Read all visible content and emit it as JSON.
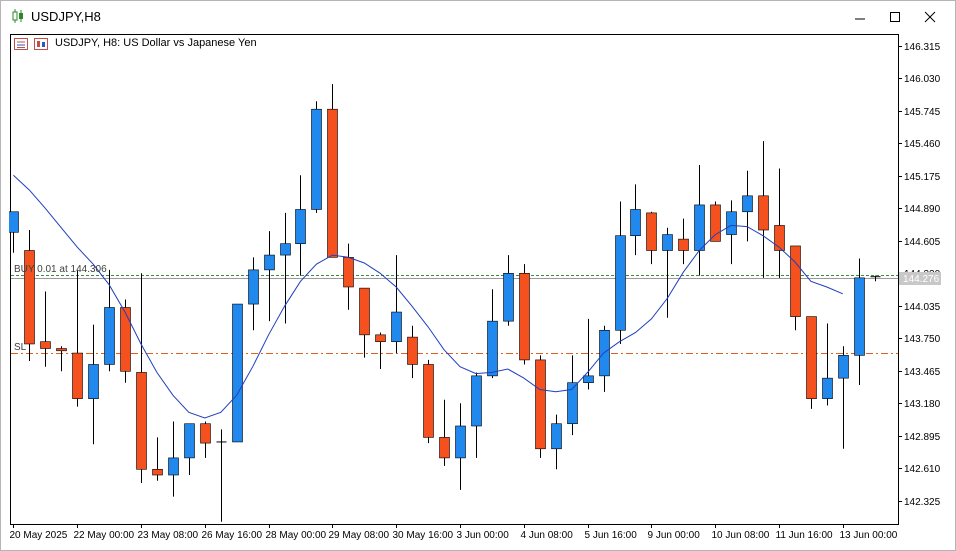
{
  "window": {
    "title": "USDJPY,H8"
  },
  "chart_header": {
    "description": "USDJPY, H8:  US Dollar vs Japanese Yen"
  },
  "trade_lines": {
    "buy_label": "BUY 0.01 at 144.306",
    "buy_price": 144.306,
    "sl_label": "SL",
    "sl_price": 143.62,
    "bid_price": 144.276,
    "bid_label": "144.276"
  },
  "colors": {
    "bull": "#2189ed",
    "bear": "#f4511e",
    "ma": "#1f3fbf",
    "buy_line": "#3a8f3a",
    "sl_line": "#e06020",
    "bid_line": "#9a9a9a"
  },
  "chart_data": {
    "type": "candlestick",
    "ylim": [
      142.12,
      146.42
    ],
    "y_ticks": [
      "146.315",
      "146.030",
      "145.745",
      "145.460",
      "145.175",
      "144.890",
      "144.605",
      "144.320",
      "144.035",
      "143.750",
      "143.465",
      "143.180",
      "142.895",
      "142.610",
      "142.325"
    ],
    "x_tick_labels": [
      {
        "label": "20 May 2025",
        "index": 0
      },
      {
        "label": "22 May 00:00",
        "index": 4
      },
      {
        "label": "23 May 08:00",
        "index": 8
      },
      {
        "label": "26 May 16:00",
        "index": 12
      },
      {
        "label": "28 May 00:00",
        "index": 16
      },
      {
        "label": "29 May 08:00",
        "index": 20
      },
      {
        "label": "30 May 16:00",
        "index": 24
      },
      {
        "label": "3 Jun 00:00",
        "index": 28
      },
      {
        "label": "4 Jun 08:00",
        "index": 32
      },
      {
        "label": "5 Jun 16:00",
        "index": 36
      },
      {
        "label": "9 Jun 00:00",
        "index": 40
      },
      {
        "label": "10 Jun 08:00",
        "index": 44
      },
      {
        "label": "11 Jun 16:00",
        "index": 48
      },
      {
        "label": "13 Jun 00:00",
        "index": 52
      }
    ],
    "candles": [
      {
        "o": 144.68,
        "h": 144.86,
        "l": 144.5,
        "c": 144.86
      },
      {
        "o": 144.52,
        "h": 144.7,
        "l": 143.55,
        "c": 143.7
      },
      {
        "o": 143.72,
        "h": 144.16,
        "l": 143.5,
        "c": 143.66
      },
      {
        "o": 143.66,
        "h": 143.68,
        "l": 143.46,
        "c": 143.64
      },
      {
        "o": 143.62,
        "h": 144.35,
        "l": 143.15,
        "c": 143.22
      },
      {
        "o": 143.22,
        "h": 143.87,
        "l": 142.82,
        "c": 143.52
      },
      {
        "o": 143.52,
        "h": 144.35,
        "l": 143.46,
        "c": 144.02
      },
      {
        "o": 144.02,
        "h": 144.09,
        "l": 143.36,
        "c": 143.46
      },
      {
        "o": 143.45,
        "h": 144.32,
        "l": 142.48,
        "c": 142.6
      },
      {
        "o": 142.6,
        "h": 142.88,
        "l": 142.5,
        "c": 142.55
      },
      {
        "o": 142.55,
        "h": 143.02,
        "l": 142.36,
        "c": 142.7
      },
      {
        "o": 142.7,
        "h": 143.0,
        "l": 142.55,
        "c": 143.0
      },
      {
        "o": 143.0,
        "h": 143.02,
        "l": 142.7,
        "c": 142.83
      },
      {
        "o": 142.84,
        "h": 142.95,
        "l": 142.14,
        "c": 142.84
      },
      {
        "o": 142.84,
        "h": 144.05,
        "l": 142.84,
        "c": 144.05
      },
      {
        "o": 144.05,
        "h": 144.46,
        "l": 143.82,
        "c": 144.35
      },
      {
        "o": 144.35,
        "h": 144.69,
        "l": 143.9,
        "c": 144.48
      },
      {
        "o": 144.48,
        "h": 144.85,
        "l": 143.88,
        "c": 144.58
      },
      {
        "o": 144.58,
        "h": 145.18,
        "l": 144.3,
        "c": 144.88
      },
      {
        "o": 144.88,
        "h": 145.83,
        "l": 144.85,
        "c": 145.76
      },
      {
        "o": 145.76,
        "h": 145.98,
        "l": 144.46,
        "c": 144.46
      },
      {
        "o": 144.46,
        "h": 144.58,
        "l": 144.0,
        "c": 144.2
      },
      {
        "o": 144.19,
        "h": 144.19,
        "l": 143.58,
        "c": 143.78
      },
      {
        "o": 143.78,
        "h": 143.8,
        "l": 143.48,
        "c": 143.72
      },
      {
        "o": 143.72,
        "h": 144.48,
        "l": 143.62,
        "c": 143.98
      },
      {
        "o": 143.76,
        "h": 143.86,
        "l": 143.4,
        "c": 143.52
      },
      {
        "o": 143.52,
        "h": 143.56,
        "l": 142.83,
        "c": 142.88
      },
      {
        "o": 142.88,
        "h": 143.21,
        "l": 142.63,
        "c": 142.7
      },
      {
        "o": 142.7,
        "h": 143.18,
        "l": 142.42,
        "c": 142.98
      },
      {
        "o": 142.98,
        "h": 143.45,
        "l": 142.7,
        "c": 143.42
      },
      {
        "o": 143.42,
        "h": 144.18,
        "l": 143.4,
        "c": 143.9
      },
      {
        "o": 143.9,
        "h": 144.48,
        "l": 143.86,
        "c": 144.32
      },
      {
        "o": 144.32,
        "h": 144.4,
        "l": 143.52,
        "c": 143.56
      },
      {
        "o": 143.56,
        "h": 143.6,
        "l": 142.7,
        "c": 142.78
      },
      {
        "o": 142.78,
        "h": 143.08,
        "l": 142.6,
        "c": 143.0
      },
      {
        "o": 143.0,
        "h": 143.6,
        "l": 142.9,
        "c": 143.36
      },
      {
        "o": 143.36,
        "h": 143.92,
        "l": 143.3,
        "c": 143.42
      },
      {
        "o": 143.42,
        "h": 143.86,
        "l": 143.28,
        "c": 143.82
      },
      {
        "o": 143.82,
        "h": 144.95,
        "l": 143.7,
        "c": 144.65
      },
      {
        "o": 144.65,
        "h": 145.1,
        "l": 144.48,
        "c": 144.88
      },
      {
        "o": 144.85,
        "h": 144.86,
        "l": 144.4,
        "c": 144.52
      },
      {
        "o": 144.52,
        "h": 144.72,
        "l": 143.93,
        "c": 144.66
      },
      {
        "o": 144.62,
        "h": 144.8,
        "l": 144.4,
        "c": 144.52
      },
      {
        "o": 144.52,
        "h": 145.27,
        "l": 144.3,
        "c": 144.92
      },
      {
        "o": 144.92,
        "h": 144.95,
        "l": 144.6,
        "c": 144.6
      },
      {
        "o": 144.66,
        "h": 144.96,
        "l": 144.4,
        "c": 144.86
      },
      {
        "o": 144.86,
        "h": 145.22,
        "l": 144.6,
        "c": 145.0
      },
      {
        "o": 145.0,
        "h": 145.48,
        "l": 144.28,
        "c": 144.7
      },
      {
        "o": 144.74,
        "h": 145.24,
        "l": 144.28,
        "c": 144.52
      },
      {
        "o": 144.56,
        "h": 144.56,
        "l": 143.82,
        "c": 143.94
      },
      {
        "o": 143.94,
        "h": 143.94,
        "l": 143.13,
        "c": 143.22
      },
      {
        "o": 143.22,
        "h": 143.88,
        "l": 143.16,
        "c": 143.4
      },
      {
        "o": 143.4,
        "h": 143.68,
        "l": 142.78,
        "c": 143.6
      },
      {
        "o": 143.6,
        "h": 144.45,
        "l": 143.34,
        "c": 144.28
      },
      {
        "o": 144.29,
        "h": 144.3,
        "l": 144.25,
        "c": 144.28
      }
    ],
    "moving_average": [
      145.18,
      145.05,
      144.89,
      144.72,
      144.55,
      144.4,
      144.22,
      143.98,
      143.7,
      143.45,
      143.25,
      143.1,
      143.05,
      143.1,
      143.25,
      143.5,
      143.78,
      144.03,
      144.25,
      144.4,
      144.48,
      144.46,
      144.41,
      144.32,
      144.2,
      144.03,
      143.85,
      143.65,
      143.5,
      143.44,
      143.45,
      143.48,
      143.4,
      143.3,
      143.28,
      143.3,
      143.45,
      143.62,
      143.72,
      143.8,
      143.92,
      144.1,
      144.33,
      144.52,
      144.66,
      144.74,
      144.73,
      144.65,
      144.55,
      144.42,
      144.25,
      144.2,
      144.14
    ]
  }
}
